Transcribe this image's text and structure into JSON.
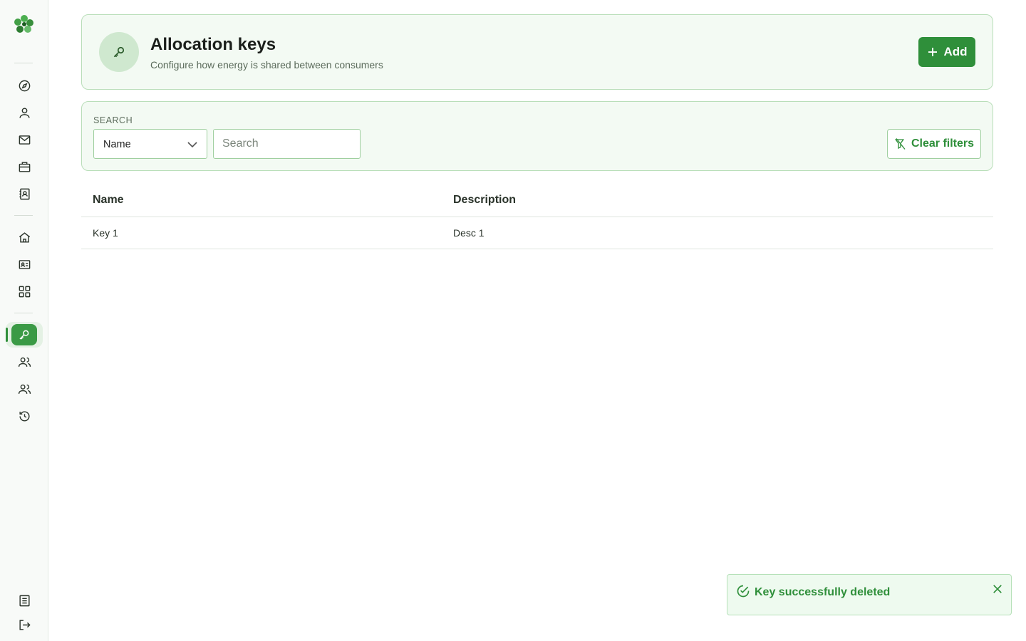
{
  "app": {
    "logo_icon": "clover-logo-icon",
    "accent_color": "#2f8f3a"
  },
  "sidebar": {
    "items": [
      {
        "icon": "compass-icon"
      },
      {
        "icon": "user-icon"
      },
      {
        "icon": "mail-icon"
      },
      {
        "icon": "briefcase-icon"
      },
      {
        "icon": "contact-book-icon"
      },
      {
        "icon": "home-icon"
      },
      {
        "icon": "id-card-icon"
      },
      {
        "icon": "grid-icon"
      },
      {
        "icon": "key-icon",
        "active": true
      },
      {
        "icon": "users-icon"
      },
      {
        "icon": "users-icon"
      },
      {
        "icon": "history-icon"
      }
    ],
    "bottom_items": [
      {
        "icon": "document-icon"
      },
      {
        "icon": "logout-icon"
      }
    ]
  },
  "header": {
    "title": "Allocation keys",
    "subtitle": "Configure how energy is shared between consumers",
    "icon": "key-icon",
    "add_label": "Add"
  },
  "filters": {
    "label": "SEARCH",
    "field_selected": "Name",
    "search_placeholder": "Search",
    "search_value": "",
    "clear_label": "Clear filters"
  },
  "table": {
    "columns": [
      "Name",
      "Description"
    ],
    "rows": [
      {
        "name": "Key 1",
        "description": "Desc 1"
      }
    ]
  },
  "toast": {
    "message": "Key successfully deleted",
    "status_color": "#2f8f3a"
  }
}
